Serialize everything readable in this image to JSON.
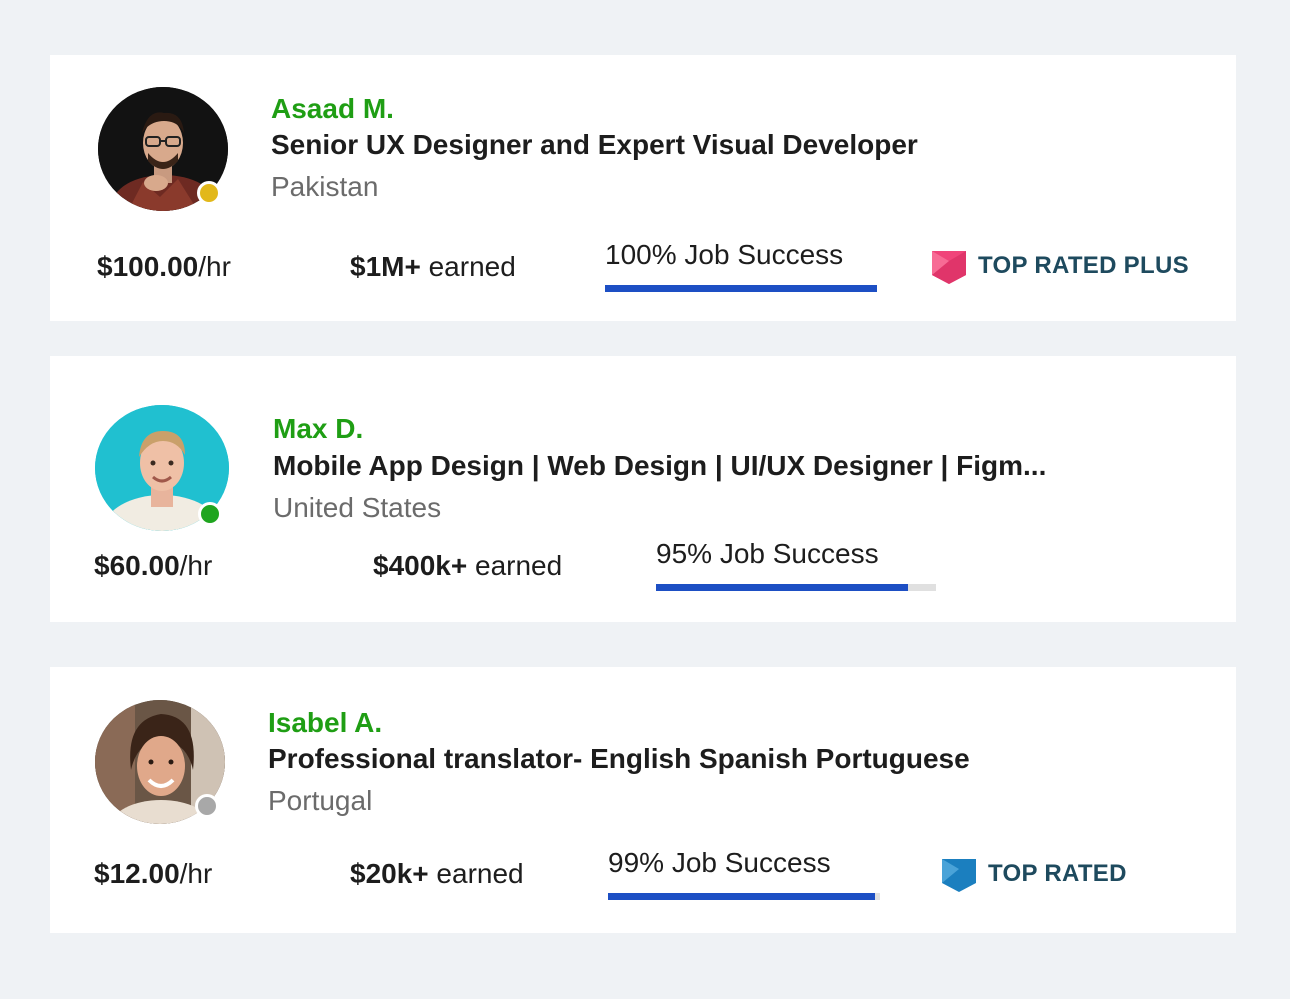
{
  "colors": {
    "name": "#1f9e14",
    "progress": "#1d4fc4",
    "badge_text": "#1e4a5e",
    "top_rated_plus": "#f0447a",
    "top_rated": "#1b7fbf",
    "status_away": "#e2b81a",
    "status_online": "#1fa51f",
    "status_offline": "#a8a8a8"
  },
  "freelancers": [
    {
      "name": "Asaad M.",
      "title": "Senior UX Designer and Expert Visual Developer",
      "country": "Pakistan",
      "rate_amount": "$100.00",
      "rate_unit": "/hr",
      "earned_amount": "$1M+",
      "earned_label": " earned",
      "job_success": "100% Job Success",
      "job_success_fraction": 1.0,
      "status": "away",
      "badge": "TOP RATED PLUS",
      "badge_icon": "top-rated-plus-icon"
    },
    {
      "name": "Max D.",
      "title": "Mobile App Design | Web Design | UI/UX Designer | Figm...",
      "country": "United States",
      "rate_amount": "$60.00",
      "rate_unit": "/hr",
      "earned_amount": "$400k+",
      "earned_label": " earned",
      "job_success": "95% Job Success",
      "job_success_fraction": 0.9,
      "status": "online",
      "badge": "",
      "badge_icon": ""
    },
    {
      "name": "Isabel A.",
      "title": "Professional translator- English Spanish Portuguese",
      "country": "Portugal",
      "rate_amount": "$12.00",
      "rate_unit": "/hr",
      "earned_amount": "$20k+",
      "earned_label": " earned",
      "job_success": "99% Job Success",
      "job_success_fraction": 0.98,
      "status": "offline",
      "badge": "TOP RATED",
      "badge_icon": "top-rated-icon"
    }
  ]
}
